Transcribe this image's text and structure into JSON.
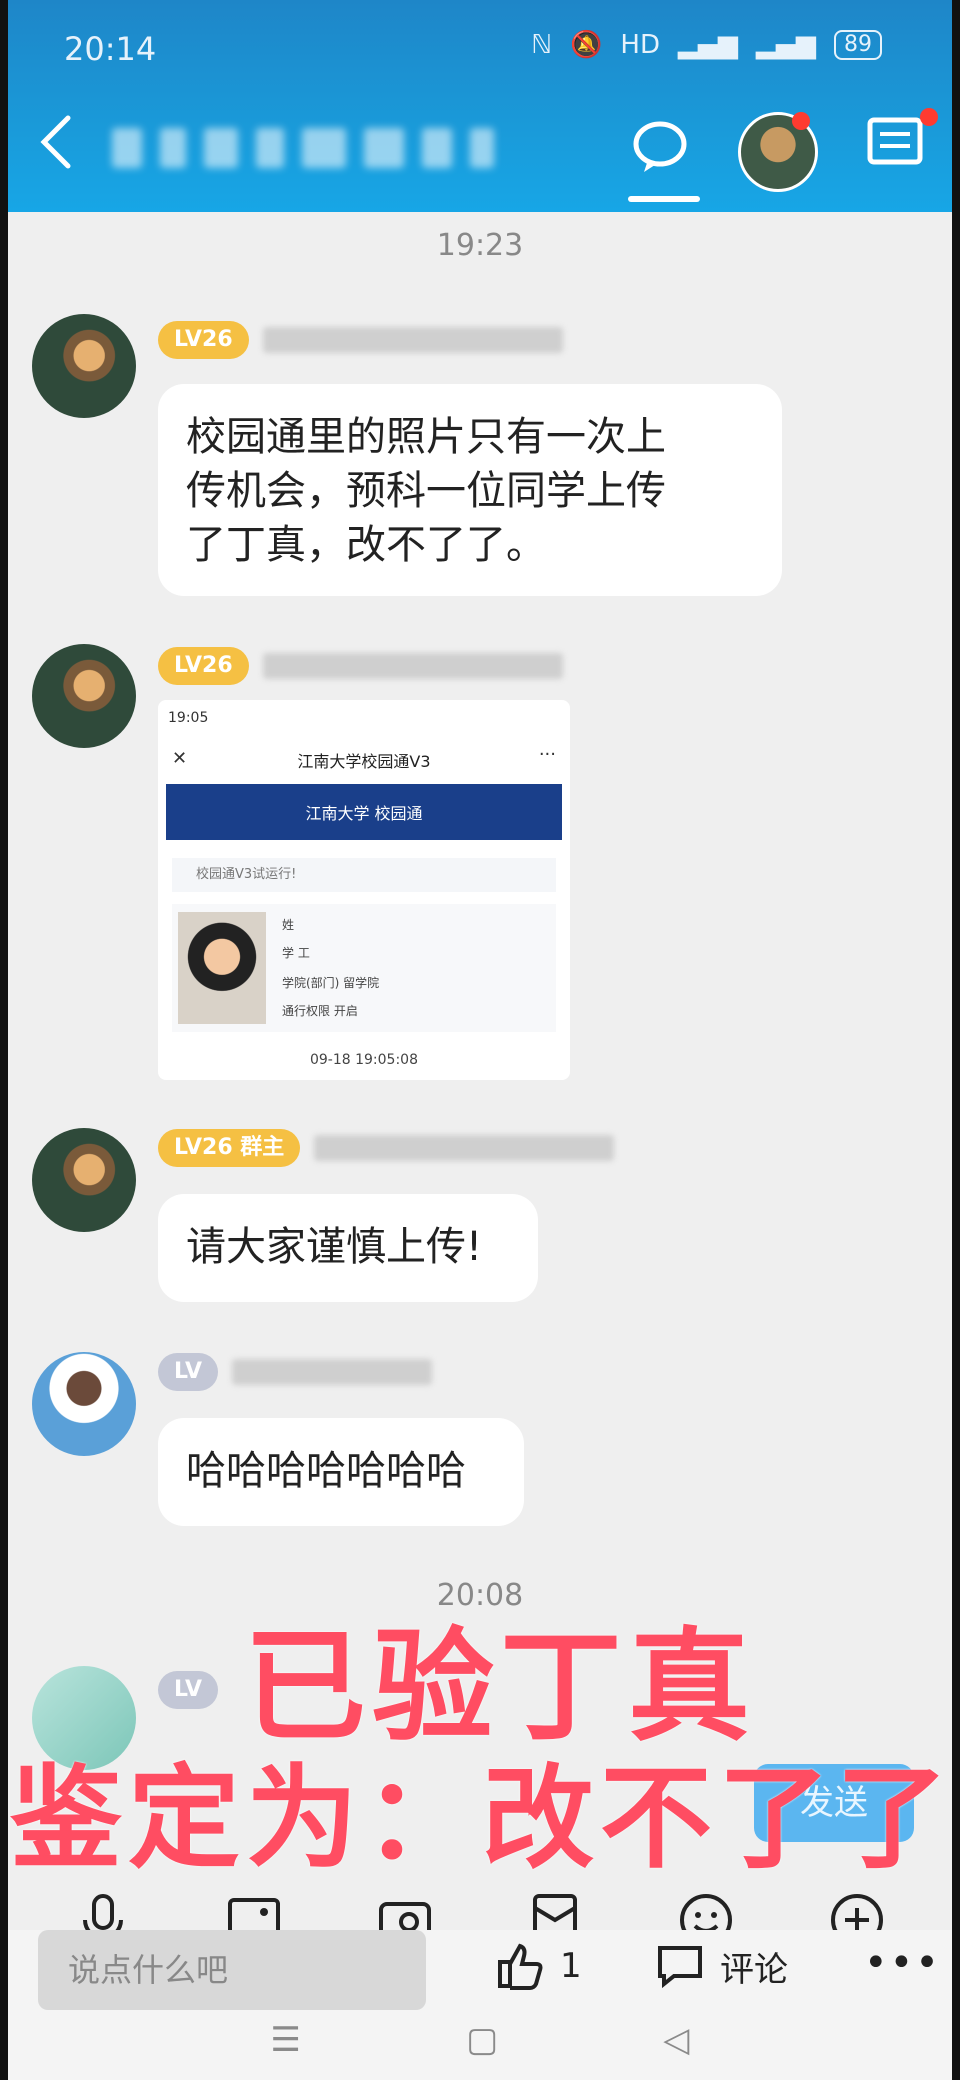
{
  "status": {
    "time": "20:14",
    "battery": "89",
    "network": "HD"
  },
  "header": {
    "title_blurred": "",
    "chat_icon": "chat-bubble-icon",
    "menu_icon": "list-icon"
  },
  "messages": {
    "ts1": "19:23",
    "m1": {
      "level": "LV26",
      "text_line1": "校园通里的照片只有一次上",
      "text_line2": "传机会，预科一位同学上传",
      "text_line3": "了丁真，改不了了。"
    },
    "m2": {
      "level": "LV26",
      "screenshot": {
        "time": "19:05",
        "title": "江南大学校园通V3",
        "bar_text": "江南大学 校园通",
        "notice": "校园通V3试运行!",
        "row1": "姓",
        "row2": "学 工",
        "row3": "学院(部门)  留学院",
        "row4": "通行权限  开启",
        "date": "09-18 19:05:08"
      }
    },
    "m3": {
      "level": "LV26 群主",
      "text": "请大家谨慎上传!"
    },
    "m4": {
      "level": "LV",
      "text": "哈哈哈哈哈哈哈"
    },
    "ts2": "20:08",
    "m5": {
      "level": "LV"
    }
  },
  "overlay": {
    "line1": "已验丁真",
    "line2": "鉴定为：改不了了"
  },
  "send_button": "发送",
  "bottom": {
    "input_placeholder": "说点什么吧",
    "like_count": "1",
    "comment_label": "评论",
    "more": "•••"
  }
}
